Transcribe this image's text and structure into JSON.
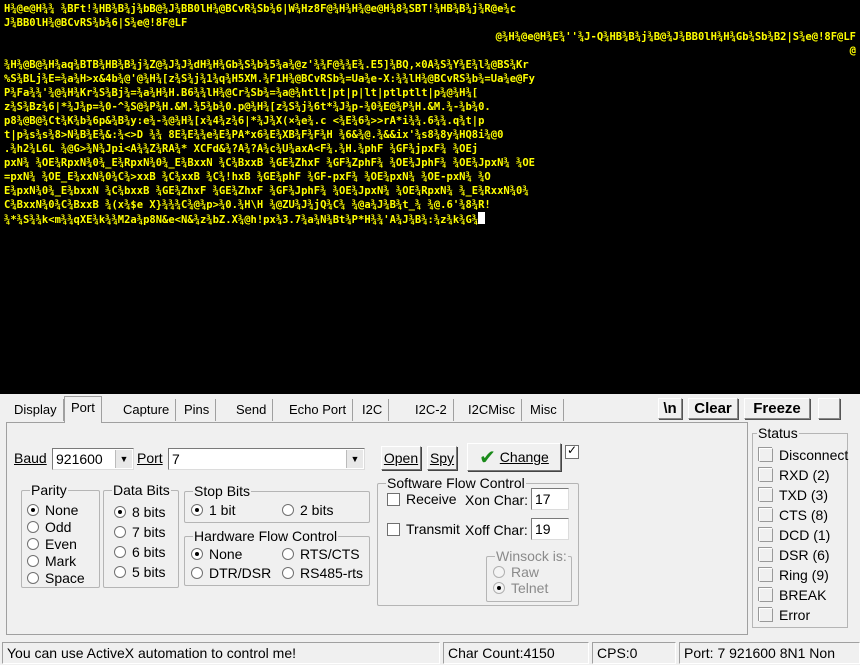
{
  "terminal": {
    "lines": [
      "H¾@e@H¾¾ ¾BFt!¾HB¾B¾j¾bB@¾J¾BB0lH¾@BCvR¾Sb¾6|W¾Hz8F@¾H¾H¾@e@H¾8¾SBT!¾HB¾B¾j¾R@e¾c",
      "J¾BB0lH¾@BCvRS¾b¾6|S¾e@!8F@LF",
      "@¾H¾@e@H¾E¾''¾J-Q¾HB¾B¾j¾B@¾J¾BB0lH¾H¾Gb¾Sb¾B2|S¾e@!8F@LF",
      "@",
      "¾H¾@B@¾H¾aq¾BTB¾HB¾B¾j¾Z@¾J¾J¾dH¾H¾Gb¾S¾b¾5¾a¾@z'¾¾F@¾¾E¾.E5]¾BQ,×0A¾S¾Y¾E¾l¾@BS¾Kr",
      "%S¾BLj¾E=¾a¾H>x&4b¾@'@¾H¾[z¾S¾j¾1¾q¾H5XM.¾F1H¾@BCvRSb¾=Ua¾e-X:¾¾lH¾@BCvRS¾b¾=Ua¾e@Fy",
      "P¾Fa¾¾'¾@¾H¾Kr¾S¾Bj¾=¾a¾H¾H.B6¾¾lH¾@Cr¾Sb¾=¾a@¾htlt|pt|p|lt|ptlptlt|p¾@¾H¾[",
      "z¾S¾Bz¾6|*¾J¾p=¾0-^¾S@¾P¾H.&M.¾5¾b¾0.p@¾H¾[z¾S¾j¾6t*¾J¾p-¾0¾E@¾P¾H.&M.¾-¾b¾0.",
      "p8¾@B@¾Ct¾K¾b¾6p&¾B¾y:e¾-¾@¾H¾[x¾4¾z¾6|*¾J¾X(×¾e¾.c <¾E¾6¾>>rA*i¾¾.6¾¾.q¾t|p",
      "t|p¾s¾s¾8>N¾B¾E¾&:¾<>D ¾¾ 8E¾E¾¾e¾E¾PA*x6¾E¾XB¾F¾F¾H ¾6&¾@.¾&&ix'¾s8¾8y¾HQ8i¾@0",
      ".¾h2¾L6L ¾@G>¾N¾Jpi<A¾¾Z¾RA¾* XCFd&¾?A¾?A¾c¾U¾axA<F¾.¾H.¾phF ¾GF¾jpxF¾ ¾OEj",
      "pxN¾ ¾OE¾RpxN¾0¾_E¾RpxN¾0¾_E¾BxxN ¾C¾BxxB ¾GE¾ZhxF ¾GF¾ZphF¾ ¾OE¾JphF¾ ¾OE¾JpxN¾ ¾OE",
      "=pxN¾ ¾OE_E¾xxN¾0¾C¾>xxB ¾C¾xxB ¾C¾!hxB ¾GE¾phF ¾GF-pxF¾ ¾OE¾pxN¾ ¾OE-pxN¾ ¾O",
      "E¾pxN¾0¾_E¾bxxN ¾C¾bxxB ¾GE¾ZhxF ¾GE¾ZhxF ¾GF¾JphF¾ ¾OE¾JpxN¾ ¾OE¾RpxN¾ ¾_E¾RxxN¾0¾",
      "C¾BxxN¾0¾C¾BxxB ¾(x¾$e X}¾¾¾C¾@¾p>¾0.¾H\\H ¾@ZU¾J¾jQ¾C¾ ¾@a¾J¾B¾t_¾ ¾@.6'¾8¾R!",
      "¾*¾S¾¾k<m¾¾qXE¾k¾¾M2a¾p8N&e<N&¾z¾bZ.X¾@h!px¾3.7¾a¾N¾Bt¾P*H¾¾'A¾J¾B¾:¾z¾k¾G¾"
    ]
  },
  "tabs": [
    "Display",
    "Port",
    "Capture",
    "Pins",
    "Send",
    "Echo Port",
    "I2C",
    "I2C-2",
    "I2CMisc",
    "Misc"
  ],
  "toolbar": {
    "newline_label": "\\n",
    "clear_label": "Clear",
    "freeze_label": "Freeze"
  },
  "port": {
    "baud_label": "Baud",
    "baud_value": "921600",
    "port_label": "Port",
    "port_value": "7",
    "open_label": "Open",
    "spy_label": "Spy",
    "change_label": "Change"
  },
  "parity": {
    "title": "Parity",
    "options": [
      "None",
      "Odd",
      "Even",
      "Mark",
      "Space"
    ],
    "selected": 0
  },
  "databits": {
    "title": "Data Bits",
    "options": [
      "8 bits",
      "7 bits",
      "6 bits",
      "5 bits"
    ],
    "selected": 0
  },
  "stopbits": {
    "title": "Stop Bits",
    "options": [
      "1 bit",
      "2 bits"
    ],
    "selected": 0
  },
  "hwflow": {
    "title": "Hardware Flow Control",
    "options": [
      "None",
      "RTS/CTS",
      "DTR/DSR",
      "RS485-rts"
    ],
    "selected": 0
  },
  "swflow": {
    "title": "Software Flow Control",
    "receive_label": "Receive",
    "transmit_label": "Transmit",
    "xon_label": "Xon Char:",
    "xon_value": "17",
    "xoff_label": "Xoff Char:",
    "xoff_value": "19"
  },
  "winsock": {
    "title": "Winsock is:",
    "options": [
      "Raw",
      "Telnet"
    ],
    "selected": 1
  },
  "status": {
    "title": "Status",
    "items": [
      "Disconnect",
      "RXD (2)",
      "TXD (3)",
      "CTS (8)",
      "DCD (1)",
      "DSR (6)",
      "Ring (9)",
      "BREAK",
      "Error"
    ]
  },
  "statusbar": {
    "message": "You can use ActiveX automation to control me!",
    "char_count": "Char Count:4150",
    "cps": "CPS:0",
    "port_info": "Port: 7 921600 8N1 Non"
  },
  "colors": {
    "terminal_bg": "#000000",
    "terminal_fg": "#ffff00",
    "change_check": "#1a8a1a"
  }
}
